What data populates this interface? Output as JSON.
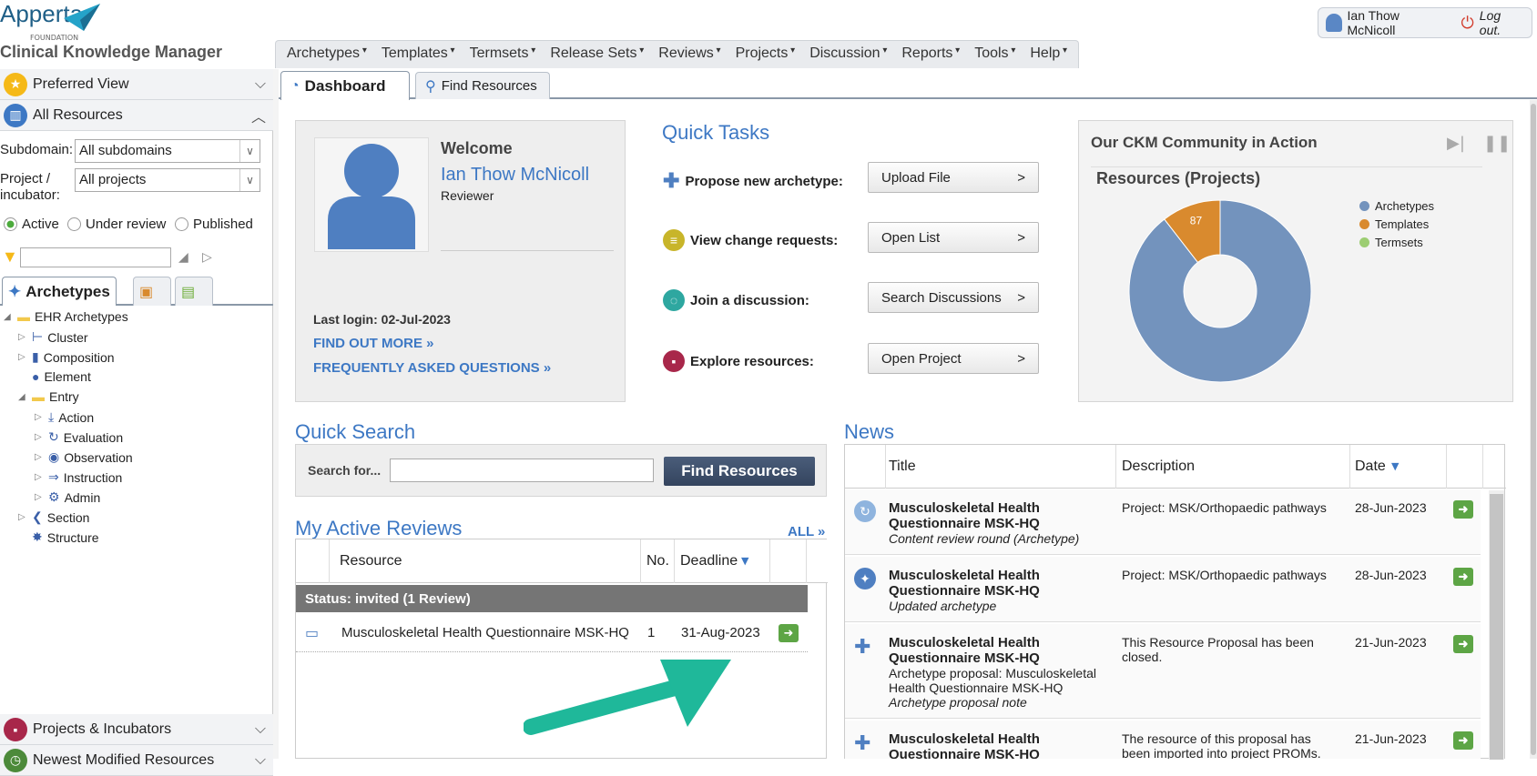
{
  "header": {
    "brand": "Apperta",
    "brand_sub": "FOUNDATION",
    "app_title": "Clinical Knowledge Manager",
    "user_name": "Ian Thow McNicoll",
    "logout_label": "Log out."
  },
  "menu": [
    "Archetypes",
    "Templates",
    "Termsets",
    "Release Sets",
    "Reviews",
    "Projects",
    "Discussion",
    "Reports",
    "Tools",
    "Help"
  ],
  "tabs": {
    "dashboard": "Dashboard",
    "find_resources": "Find Resources"
  },
  "left": {
    "preferred_view": "Preferred View",
    "all_resources": "All Resources",
    "subdomain_label": "Subdomain:",
    "subdomain_value": "All subdomains",
    "project_label_1": "Project /",
    "project_label_2": "incubator:",
    "project_value": "All projects",
    "radios": [
      "Active",
      "Under review",
      "Published"
    ],
    "archetypes_tab": "Archetypes",
    "tree": [
      "EHR Archetypes",
      "Cluster",
      "Composition",
      "Element",
      "Entry",
      "Action",
      "Evaluation",
      "Observation",
      "Instruction",
      "Admin",
      "Section",
      "Structure"
    ],
    "projects_incubators": "Projects & Incubators",
    "newest": "Newest Modified Resources"
  },
  "welcome": {
    "title": "Welcome",
    "name": "Ian Thow McNicoll",
    "role": "Reviewer",
    "last_login": "Last login: 02-Jul-2023",
    "find_out_more": "FIND OUT MORE »",
    "faq": "FREQUENTLY ASKED QUESTIONS »"
  },
  "quick_tasks": {
    "title": "Quick Tasks",
    "rows": [
      {
        "label": "Propose new archetype:",
        "button": "Upload File"
      },
      {
        "label": "View change requests:",
        "button": "Open List"
      },
      {
        "label": "Join a discussion:",
        "button": "Search Discussions"
      },
      {
        "label": "Explore resources:",
        "button": "Open Project"
      }
    ]
  },
  "community": {
    "title": "Our CKM Community in Action",
    "subtitle": "Resources (Projects)"
  },
  "chart_data": {
    "type": "pie",
    "title": "Resources (Projects)",
    "categories": [
      "Archetypes",
      "Templates",
      "Termsets"
    ],
    "values": [
      742,
      87,
      0
    ],
    "colors": [
      "#7393bd",
      "#d98a2e",
      "#9ccd72"
    ],
    "legend": "top-right"
  },
  "quick_search": {
    "title": "Quick Search",
    "label": "Search for...",
    "input_value": "",
    "button": "Find Resources"
  },
  "reviews": {
    "title": "My Active Reviews",
    "all_link": "ALL »",
    "columns": [
      "Resource",
      "No.",
      "Deadline"
    ],
    "group": "Status: invited (1 Review)",
    "rows": [
      {
        "resource": "Musculoskeletal Health Questionnaire MSK-HQ",
        "no": "1",
        "deadline": "31-Aug-2023"
      }
    ]
  },
  "news": {
    "title": "News",
    "columns": [
      "Title",
      "Description",
      "Date"
    ],
    "rows": [
      {
        "title": "Musculoskeletal Health Questionnaire MSK-HQ",
        "sub": "",
        "note": "Content review round (Archetype)",
        "desc": "Project: MSK/Orthopaedic pathways",
        "date": "28-Jun-2023"
      },
      {
        "title": "Musculoskeletal Health Questionnaire MSK-HQ",
        "sub": "",
        "note": "Updated archetype",
        "desc": "Project: MSK/Orthopaedic pathways",
        "date": "28-Jun-2023"
      },
      {
        "title": "Musculoskeletal Health Questionnaire MSK-HQ",
        "sub": "Archetype proposal: Musculoskeletal Health Questionnaire MSK-HQ",
        "note": "Archetype proposal note",
        "desc": "This Resource Proposal has been closed.",
        "date": "21-Jun-2023"
      },
      {
        "title": "Musculoskeletal Health Questionnaire MSK-HQ",
        "sub": "",
        "note": "",
        "desc": "The resource of this proposal has been imported into project PROMs.",
        "date": "21-Jun-2023"
      }
    ]
  }
}
